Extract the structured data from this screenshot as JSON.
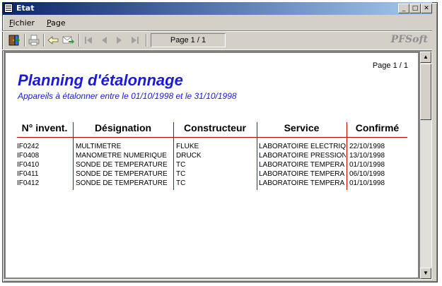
{
  "window": {
    "title": "Etat"
  },
  "menu": {
    "items": [
      {
        "accel": "F",
        "rest": "ichier"
      },
      {
        "accel": "P",
        "rest": "age"
      }
    ]
  },
  "toolbar": {
    "page_indicator": "Page 1 / 1",
    "brand": "PFSoft"
  },
  "report": {
    "page_num": "Page 1 / 1",
    "title": "Planning d'étalonnage",
    "subtitle": "Appareils à étalonner entre le 01/10/1998 et le 31/10/1998",
    "headers": [
      "N° invent.",
      "Désignation",
      "Constructeur",
      "Service",
      "Confirmé"
    ],
    "rows": [
      [
        "IF0242",
        "MULTIMÈTRE",
        "FLUKE",
        "LABORATOIRE ELECTRIQ",
        "22/10/1998"
      ],
      [
        "IF0408",
        "MANOMETRE NUMERIQUE",
        "DRUCK",
        "LABORATOIRE PRESSION",
        "13/10/1998"
      ],
      [
        "IF0410",
        "SONDE DE TEMPERATURE",
        "TC",
        "LABORATOIRE TEMPERA",
        "01/10/1998"
      ],
      [
        "IF0411",
        "SONDE DE TEMPERATURE",
        "TC",
        "LABORATOIRE TEMPERA",
        "06/10/1998"
      ],
      [
        "IF0412",
        "SONDE DE TEMPERATURE",
        "TC",
        "LABORATOIRE TEMPERA",
        "01/10/1998"
      ]
    ]
  },
  "colors": {
    "title_blue": "#1a1adb",
    "rule_red": "#c00000",
    "titlebar_start": "#0a246a",
    "titlebar_end": "#a6caf0"
  },
  "icons": [
    "app-icon",
    "exit-icon",
    "print-icon",
    "back-icon",
    "forward-icon",
    "first-page-icon",
    "prev-page-icon",
    "next-page-icon",
    "last-page-icon"
  ]
}
